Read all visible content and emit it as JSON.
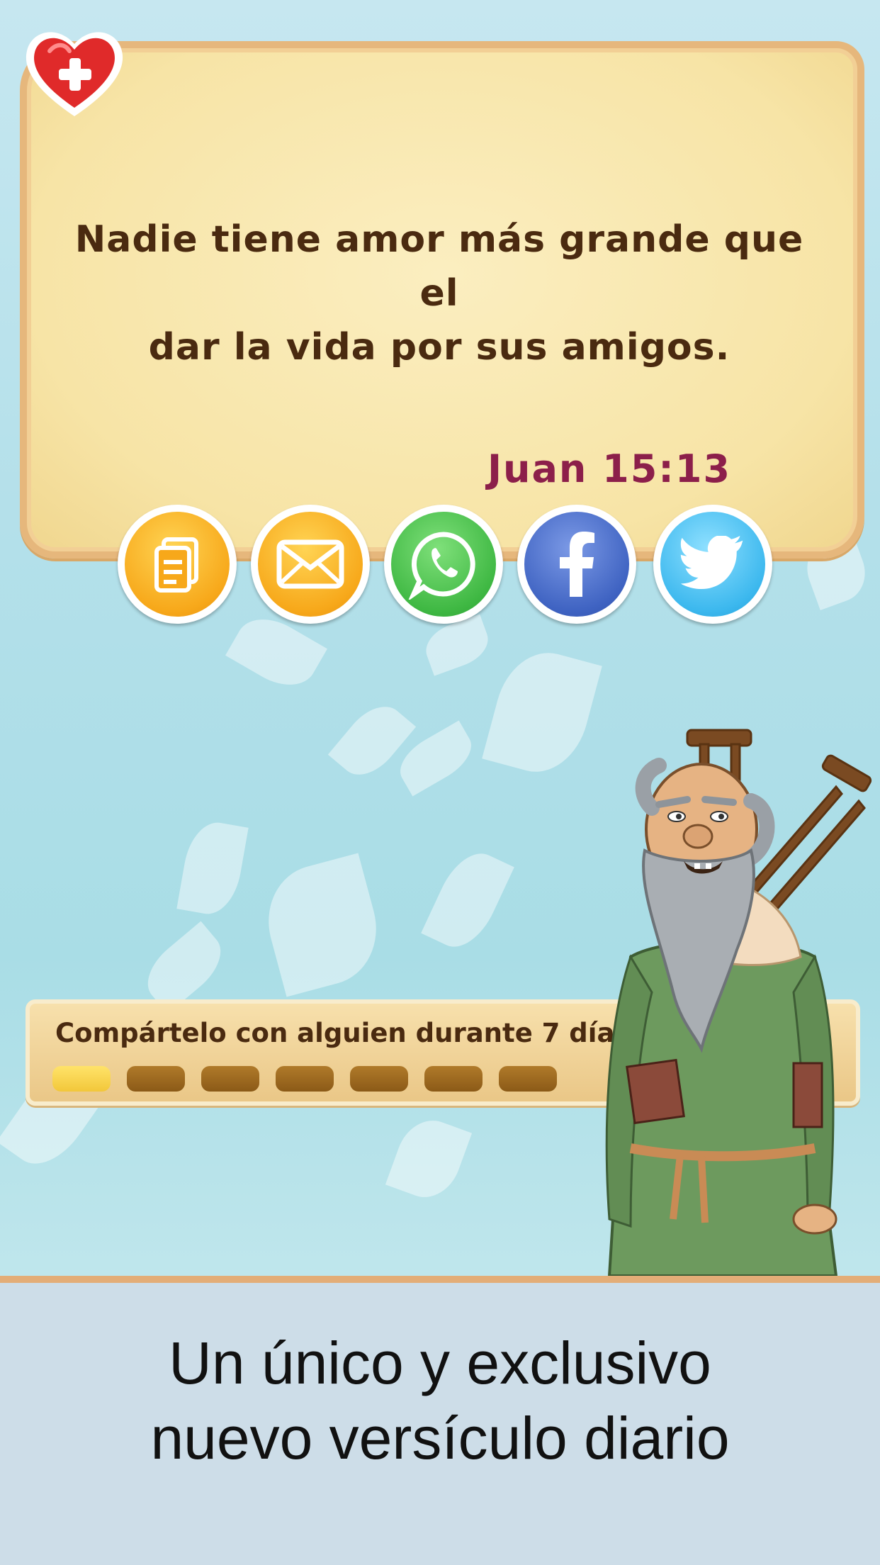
{
  "verse": {
    "line1": "Nadie tiene amor más grande que el",
    "line2": "dar la vida por sus amigos.",
    "reference": "Juan 15:13"
  },
  "favorite_button": {
    "icon": "heart-plus-icon"
  },
  "share_buttons": [
    {
      "icon": "copy-document-icon",
      "color": "#f7a81a"
    },
    {
      "icon": "mail-envelope-icon",
      "color": "#f7a81a"
    },
    {
      "icon": "whatsapp-icon",
      "color": "#3fb843"
    },
    {
      "icon": "facebook-icon",
      "color": "#3f63c2"
    },
    {
      "icon": "twitter-icon",
      "color": "#3cb8ee"
    }
  ],
  "progress": {
    "label": "Compártelo con alguien durante 7 días",
    "completed": 1,
    "total": 7
  },
  "footer": {
    "line1": "Un único y exclusivo",
    "line2": "nuevo versículo diario"
  },
  "colors": {
    "verse_text": "#4a2a10",
    "reference_text": "#8c1f4a",
    "card_bg": "#f7e4a6",
    "footer_bg": "#cddde8"
  }
}
